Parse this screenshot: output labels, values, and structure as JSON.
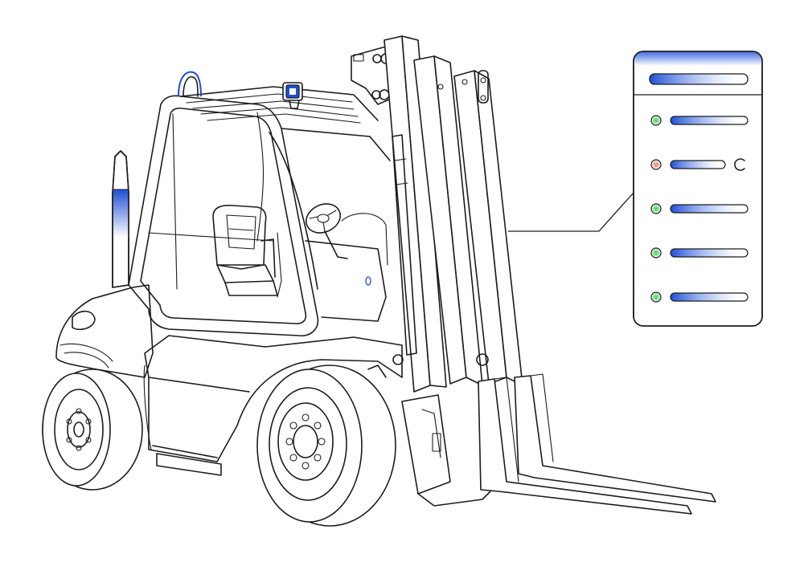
{
  "colors": {
    "line": "#1c1c1c",
    "accent": "#1f4fd6",
    "status_ok": "#3fcf5a",
    "status_fault": "#e08a8a",
    "panel_bg": "#ffffff"
  },
  "status_panel": {
    "header_bar": {
      "style": "gradient-bar"
    },
    "rows": [
      {
        "status": "ok",
        "icon": ""
      },
      {
        "status": "fault",
        "icon": "refresh-icon"
      },
      {
        "status": "ok",
        "icon": ""
      },
      {
        "status": "ok",
        "icon": ""
      },
      {
        "status": "ok",
        "icon": ""
      }
    ]
  },
  "illustration": {
    "subject": "forklift",
    "icons": [
      "beacon-light-icon",
      "work-light-icon",
      "exhaust-stack-icon",
      "steering-wheel-icon",
      "seat-icon",
      "fork-icon"
    ]
  }
}
